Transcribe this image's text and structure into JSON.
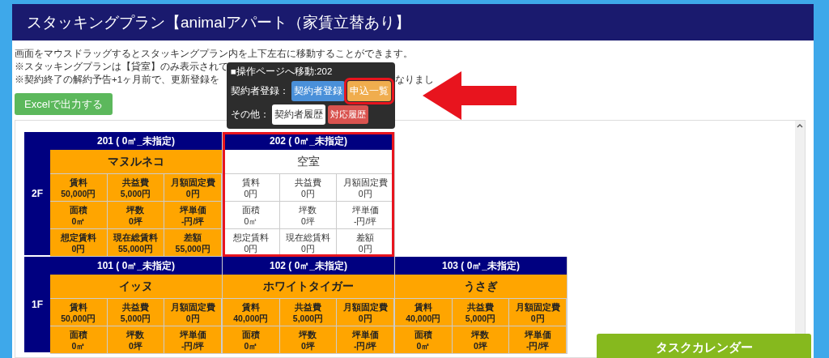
{
  "header": {
    "title": "スタッキングプラン【animalアパート（家賃立替あり】"
  },
  "notes": {
    "line_1": "画面をマウスドラッグするとスタッキングプラン内を上下左右に移動することができます。",
    "line_2": "※スタッキングプランは【貸室】のみ表示されて",
    "line_3_left": "※契約終了の解約予告+1ヶ月前で、更新登録を",
    "line_3_right": "なりまし"
  },
  "export_button": "Excelで出力する",
  "floors": [
    {
      "label": "2F",
      "rooms": [
        {
          "header": "201 ( 0㎡_未指定)",
          "occupant": "マヌルネコ",
          "vacant": false,
          "highlighted": false,
          "fields": [
            {
              "label": "賃料",
              "value": "50,000円"
            },
            {
              "label": "共益費",
              "value": "5,000円"
            },
            {
              "label": "月額固定費",
              "value": "0円"
            },
            {
              "label": "面積",
              "value": "0㎡"
            },
            {
              "label": "坪数",
              "value": "0坪"
            },
            {
              "label": "坪単価",
              "value": "-円/坪"
            },
            {
              "label": "想定賃料",
              "value": "0円"
            },
            {
              "label": "現在総賃料",
              "value": "55,000円"
            },
            {
              "label": "差額",
              "value": "55,000円"
            }
          ]
        },
        {
          "header": "202 ( 0㎡_未指定)",
          "occupant": "空室",
          "vacant": true,
          "highlighted": true,
          "fields": [
            {
              "label": "賃料",
              "value": "0円"
            },
            {
              "label": "共益費",
              "value": "0円"
            },
            {
              "label": "月額固定費",
              "value": "0円"
            },
            {
              "label": "面積",
              "value": "0㎡"
            },
            {
              "label": "坪数",
              "value": "0坪"
            },
            {
              "label": "坪単価",
              "value": "-円/坪"
            },
            {
              "label": "想定賃料",
              "value": "0円"
            },
            {
              "label": "現在総賃料",
              "value": "0円"
            },
            {
              "label": "差額",
              "value": "0円"
            }
          ]
        }
      ]
    },
    {
      "label": "1F",
      "rooms": [
        {
          "header": "101 ( 0㎡_未指定)",
          "occupant": "イッヌ",
          "vacant": false,
          "highlighted": false,
          "fields": [
            {
              "label": "賃料",
              "value": "50,000円"
            },
            {
              "label": "共益費",
              "value": "5,000円"
            },
            {
              "label": "月額固定費",
              "value": "0円"
            },
            {
              "label": "面積",
              "value": "0㎡"
            },
            {
              "label": "坪数",
              "value": "0坪"
            },
            {
              "label": "坪単価",
              "value": "-円/坪"
            }
          ]
        },
        {
          "header": "102 ( 0㎡_未指定)",
          "occupant": "ホワイトタイガー",
          "vacant": false,
          "highlighted": false,
          "fields": [
            {
              "label": "賃料",
              "value": "40,000円"
            },
            {
              "label": "共益費",
              "value": "5,000円"
            },
            {
              "label": "月額固定費",
              "value": "0円"
            },
            {
              "label": "面積",
              "value": "0㎡"
            },
            {
              "label": "坪数",
              "value": "0坪"
            },
            {
              "label": "坪単価",
              "value": "-円/坪"
            }
          ]
        },
        {
          "header": "103 ( 0㎡_未指定)",
          "occupant": "うさぎ",
          "vacant": false,
          "highlighted": false,
          "fields": [
            {
              "label": "賃料",
              "value": "40,000円"
            },
            {
              "label": "共益費",
              "value": "5,000円"
            },
            {
              "label": "月額固定費",
              "value": "0円"
            },
            {
              "label": "面積",
              "value": "0㎡"
            },
            {
              "label": "坪数",
              "value": "0坪"
            },
            {
              "label": "坪単価",
              "value": "-円/坪"
            }
          ]
        }
      ]
    }
  ],
  "popup": {
    "title": "■操作ページへ移動:202",
    "rows": [
      {
        "label": "契約者登録：",
        "buttons": [
          {
            "label": "契約者登録",
            "kind": "primary",
            "highlighted": false
          },
          {
            "label": "申込一覧",
            "kind": "warning",
            "highlighted": true
          }
        ]
      },
      {
        "label": "その他：",
        "buttons": [
          {
            "label": "契約者履歴",
            "kind": "default",
            "highlighted": false
          },
          {
            "label": "対応履歴",
            "kind": "danger",
            "highlighted": false
          }
        ]
      }
    ]
  },
  "task_calendar_button": "タスクカレンダー"
}
